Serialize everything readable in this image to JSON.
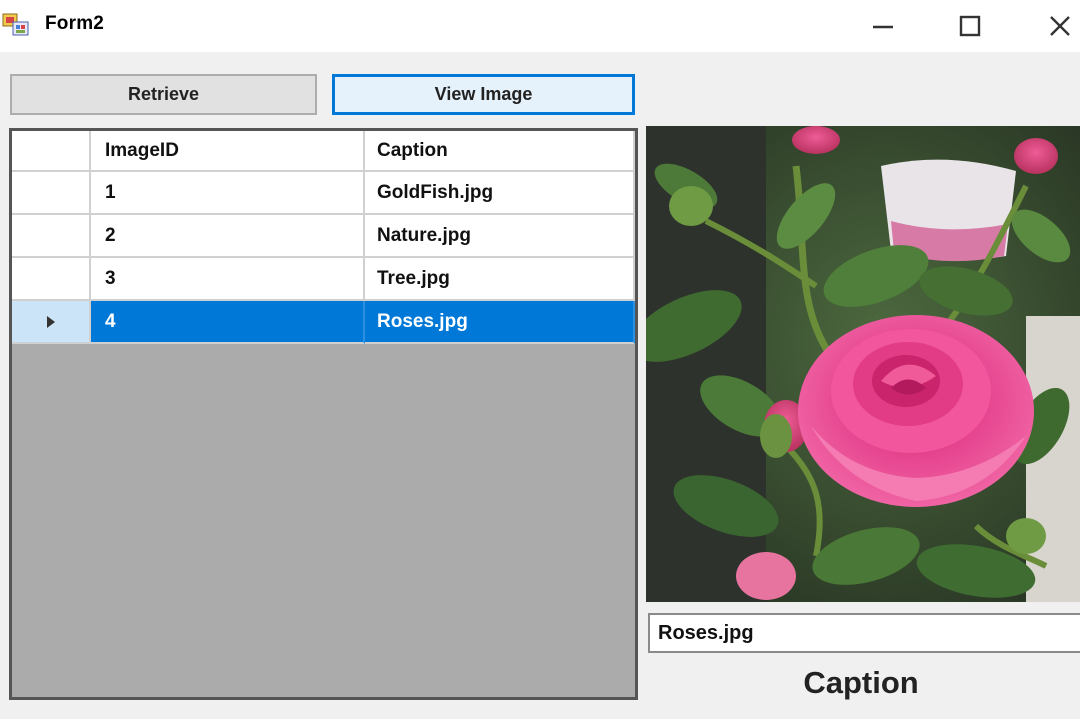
{
  "window": {
    "title": "Form2",
    "controls": {
      "minimize_icon": "minimize-icon",
      "maximize_icon": "maximize-icon",
      "close_icon": "close-icon"
    }
  },
  "toolbar": {
    "retrieve_label": "Retrieve",
    "view_image_label": "View Image"
  },
  "grid": {
    "columns": [
      "",
      "ImageID",
      "Caption"
    ],
    "rows": [
      {
        "id": "1",
        "caption": "GoldFish.jpg",
        "selected": false
      },
      {
        "id": "2",
        "caption": "Nature.jpg",
        "selected": false
      },
      {
        "id": "3",
        "caption": "Tree.jpg",
        "selected": false
      },
      {
        "id": "4",
        "caption": "Roses.jpg",
        "selected": true
      }
    ],
    "selection_color": "#0078d7"
  },
  "image_panel": {
    "subject": "pink-rose-photo"
  },
  "caption_field": {
    "value": "Roses.jpg"
  },
  "caption_label": "Caption",
  "colors": {
    "accent": "#0078d7",
    "window_bg": "#f0f0f0",
    "grid_empty_bg": "#ababab"
  }
}
